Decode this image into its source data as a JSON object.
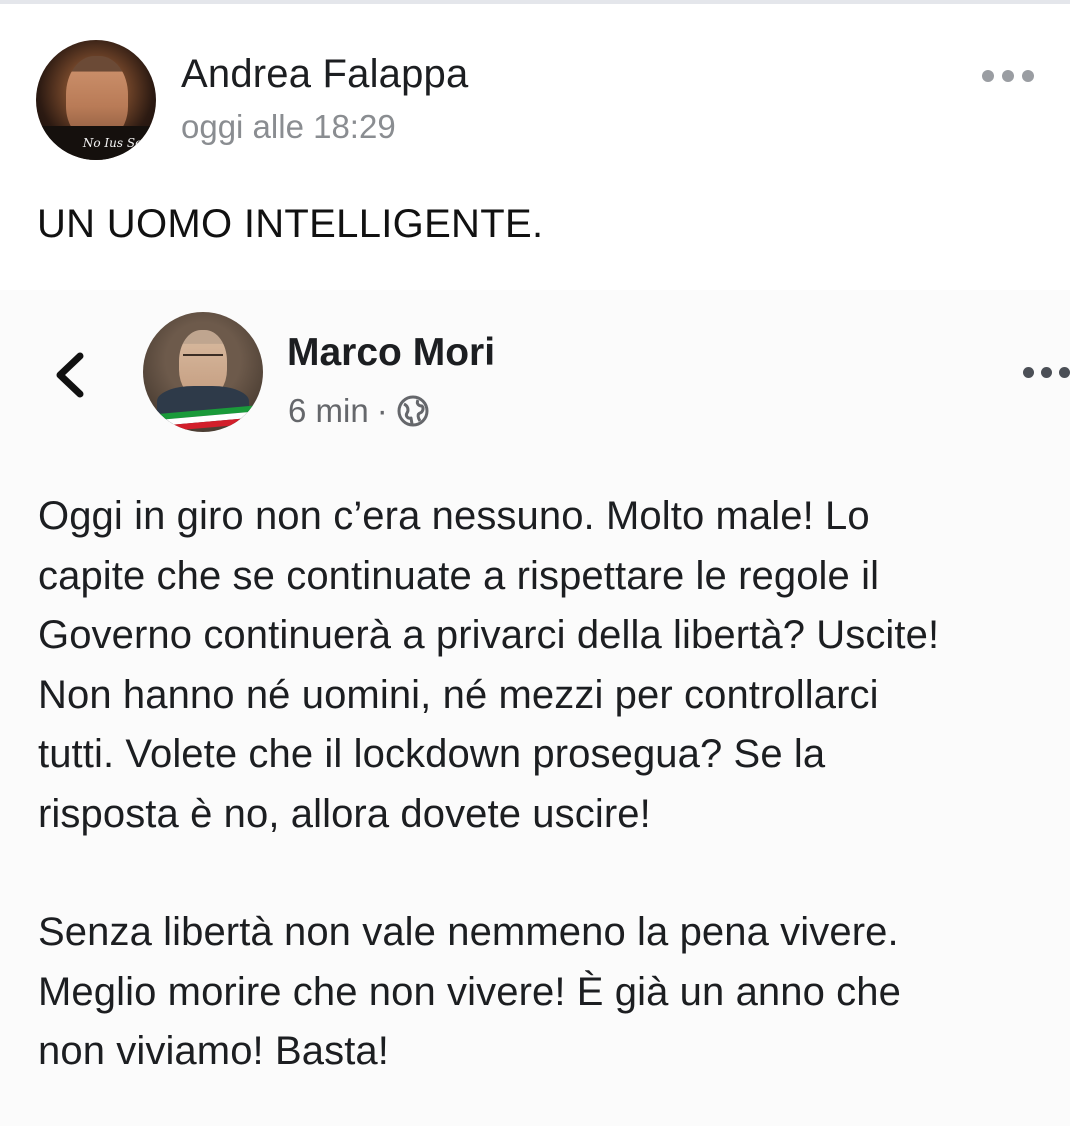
{
  "post": {
    "author": "Andrea Falappa",
    "time": "oggi alle 18:29",
    "avatar_caption": "No Ius Soli",
    "text": "UN UOMO INTELLIGENTE."
  },
  "shared_post": {
    "author": "Marco Mori",
    "time": "6 min",
    "separator": "·",
    "privacy_icon": "globe-icon",
    "paragraph1_lines": [
      "Oggi in giro non c’era nessuno. Molto male! Lo",
      "capite che se continuate a rispettare le regole il",
      "Governo continuerà a privarci della libertà? Uscite!",
      "Non hanno né uomini, né mezzi per controllarci",
      "tutti. Volete che il lockdown prosegua? Se la",
      "risposta è no, allora dovete uscire!"
    ],
    "paragraph2_lines": [
      "Senza libertà non vale nemmeno la pena vivere.",
      "Meglio morire che non vivere! È già un anno che",
      "non viviamo! Basta!"
    ]
  },
  "icons": {
    "back": "chevron-left-icon",
    "more": "more-options-icon"
  },
  "colors": {
    "name": "#1c1e21",
    "meta": "#8a8d91",
    "dots": "#9a9da2"
  }
}
